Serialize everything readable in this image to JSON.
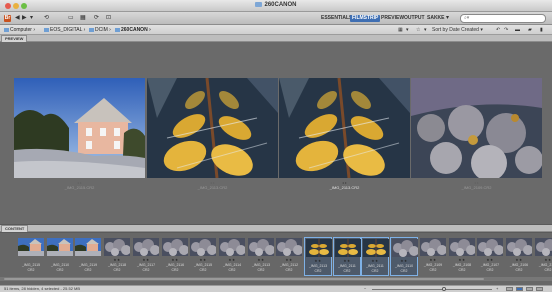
{
  "window": {
    "title": "260CANON"
  },
  "toolbar": {
    "brand_label": "Br",
    "workspaces": [
      "ESSENTIALS",
      "FILMSTRIP",
      "PREVIEW",
      "OUTPUT",
      "SAKKE"
    ],
    "active_workspace": "FILMSTRIP",
    "search_placeholder": "⌕▾"
  },
  "pathbar": {
    "crumbs": [
      "Computer",
      "EOS_DIGITAL",
      "DCIM",
      "260CANON"
    ],
    "sort_label": "Sort by Date Created"
  },
  "panels": {
    "preview_tab": "PREVIEW",
    "content_tab": "CONTENT"
  },
  "preview": {
    "captions": [
      {
        "name": "_IMG_2115.CR2"
      },
      {
        "name": "_IMG_2113.CR2"
      },
      {
        "name": "_IMG_2113.CR2"
      },
      {
        "name": "_IMG_2109.CR2"
      }
    ]
  },
  "content": {
    "thumbs": [
      {
        "name": "_IMG_2115",
        "type": "CR2",
        "stars": "",
        "selected": false,
        "kind": "house"
      },
      {
        "name": "_IMG_2110",
        "type": "CR2",
        "stars": "",
        "selected": false,
        "kind": "house"
      },
      {
        "name": "_IMG_2119",
        "type": "CR2",
        "stars": "",
        "selected": false,
        "kind": "house"
      },
      {
        "name": "_IMG_2118",
        "type": "CR2",
        "stars": "★★",
        "selected": false,
        "kind": "frost"
      },
      {
        "name": "_IMG_2117",
        "type": "CR2",
        "stars": "★★",
        "selected": false,
        "kind": "frost"
      },
      {
        "name": "_IMG_2116",
        "type": "CR2",
        "stars": "★★",
        "selected": false,
        "kind": "frost"
      },
      {
        "name": "_IMG_2115",
        "type": "CR2",
        "stars": "★★",
        "selected": false,
        "kind": "frost"
      },
      {
        "name": "_IMG_2114",
        "type": "CR2",
        "stars": "★★",
        "selected": false,
        "kind": "frost"
      },
      {
        "name": "_IMG_2113",
        "type": "CR2",
        "stars": "★★",
        "selected": false,
        "kind": "frost"
      },
      {
        "name": "_IMG_2112",
        "type": "CR2",
        "stars": "★★",
        "selected": false,
        "kind": "frost"
      },
      {
        "name": "_IMG_2113",
        "type": "CR2",
        "stars": "★★",
        "selected": true,
        "kind": "leaf"
      },
      {
        "name": "_IMG_2111",
        "type": "CR2",
        "stars": "★★",
        "selected": true,
        "kind": "leaf"
      },
      {
        "name": "_IMG_2111",
        "type": "CR2",
        "stars": "★★",
        "selected": true,
        "kind": "leaf"
      },
      {
        "name": "_IMG_2110",
        "type": "CR2",
        "stars": "★★",
        "selected": true,
        "kind": "frost"
      },
      {
        "name": "_IMG_2109",
        "type": "CR2",
        "stars": "★★",
        "selected": false,
        "kind": "frost"
      },
      {
        "name": "_IMG_2108",
        "type": "CR2",
        "stars": "★★",
        "selected": false,
        "kind": "frost"
      },
      {
        "name": "_IMG_2107",
        "type": "CR2",
        "stars": "★★",
        "selected": false,
        "kind": "frost"
      },
      {
        "name": "_IMG_2106",
        "type": "CR2",
        "stars": "★★",
        "selected": false,
        "kind": "frost"
      },
      {
        "name": "_IMG_2105",
        "type": "CR2",
        "stars": "★★",
        "selected": false,
        "kind": "frost"
      }
    ]
  },
  "status": {
    "text": "51 items, 28 hidden, 4 selected - 25.52 MB"
  },
  "colors": {
    "accent": "#3f6fb3",
    "brand": "#c8521f",
    "selection_border": "#7fb1e6"
  }
}
